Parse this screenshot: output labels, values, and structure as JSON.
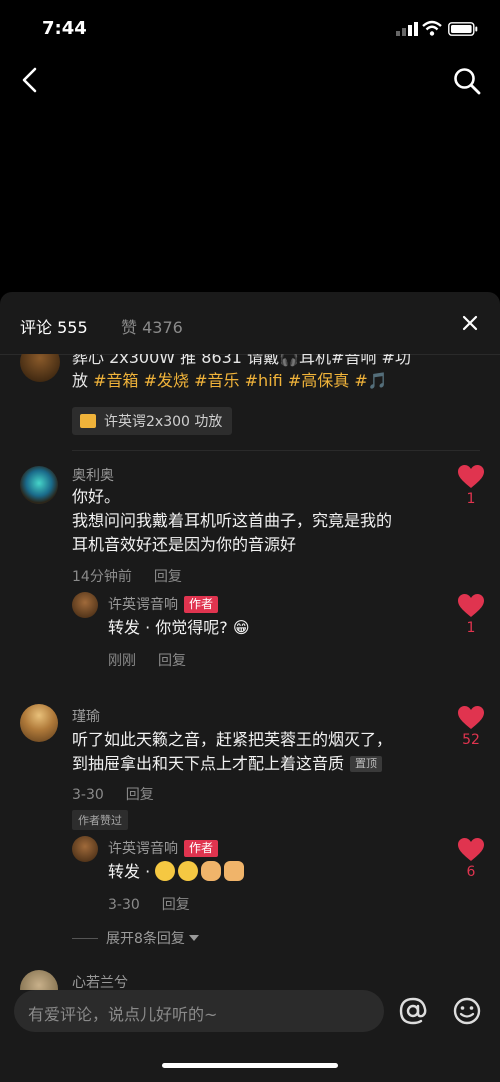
{
  "status": {
    "time": "7:44"
  },
  "sheet": {
    "tab_comments": "评论 555",
    "tab_likes": "赞 4376"
  },
  "post": {
    "line1": "葬心 2x300W 推 8631 请戴🎧耳机#音响 #功",
    "line2_parts": [
      "放 ",
      "#音箱",
      " ",
      "#发烧",
      " ",
      "#音乐",
      " ",
      "#hifi",
      " ",
      "#高保真",
      " #🎵"
    ],
    "product": "许英谔2x300 功放"
  },
  "comments": [
    {
      "author": "奥利奥",
      "lines": [
        "你好。",
        "我想问问我戴着耳机听这首曲子，究竟是我的",
        "耳机音效好还是因为你的音源好"
      ],
      "time": "14分钟前",
      "reply_label": "回复",
      "likes": "1",
      "reply": {
        "author": "许英谔音响",
        "badge": "作者",
        "text": "转发 · 你觉得呢? 😁",
        "time": "刚刚",
        "reply_label": "回复",
        "likes": "1"
      }
    },
    {
      "author": "瑾瑜",
      "lines": [
        "听了如此天籁之音，赶紧把芙蓉王的烟灭了，",
        "到抽屉拿出和天下点上才配上着这音质"
      ],
      "pinned": "置顶",
      "time": "3-30",
      "reply_label": "回复",
      "author_liked": "作者赞过",
      "likes": "52",
      "reply": {
        "author": "许英谔音响",
        "badge": "作者",
        "text": "转发 ·",
        "time": "3-30",
        "reply_label": "回复",
        "likes": "6"
      },
      "expand": "展开8条回复"
    },
    {
      "author": "心若兰兮"
    }
  ],
  "input": {
    "placeholder": "有爱评论，说点儿好听的~"
  },
  "colors": {
    "accent_red": "#e0344f",
    "hashtag": "#f0b33a",
    "sheet_bg": "#1a1a1a"
  }
}
